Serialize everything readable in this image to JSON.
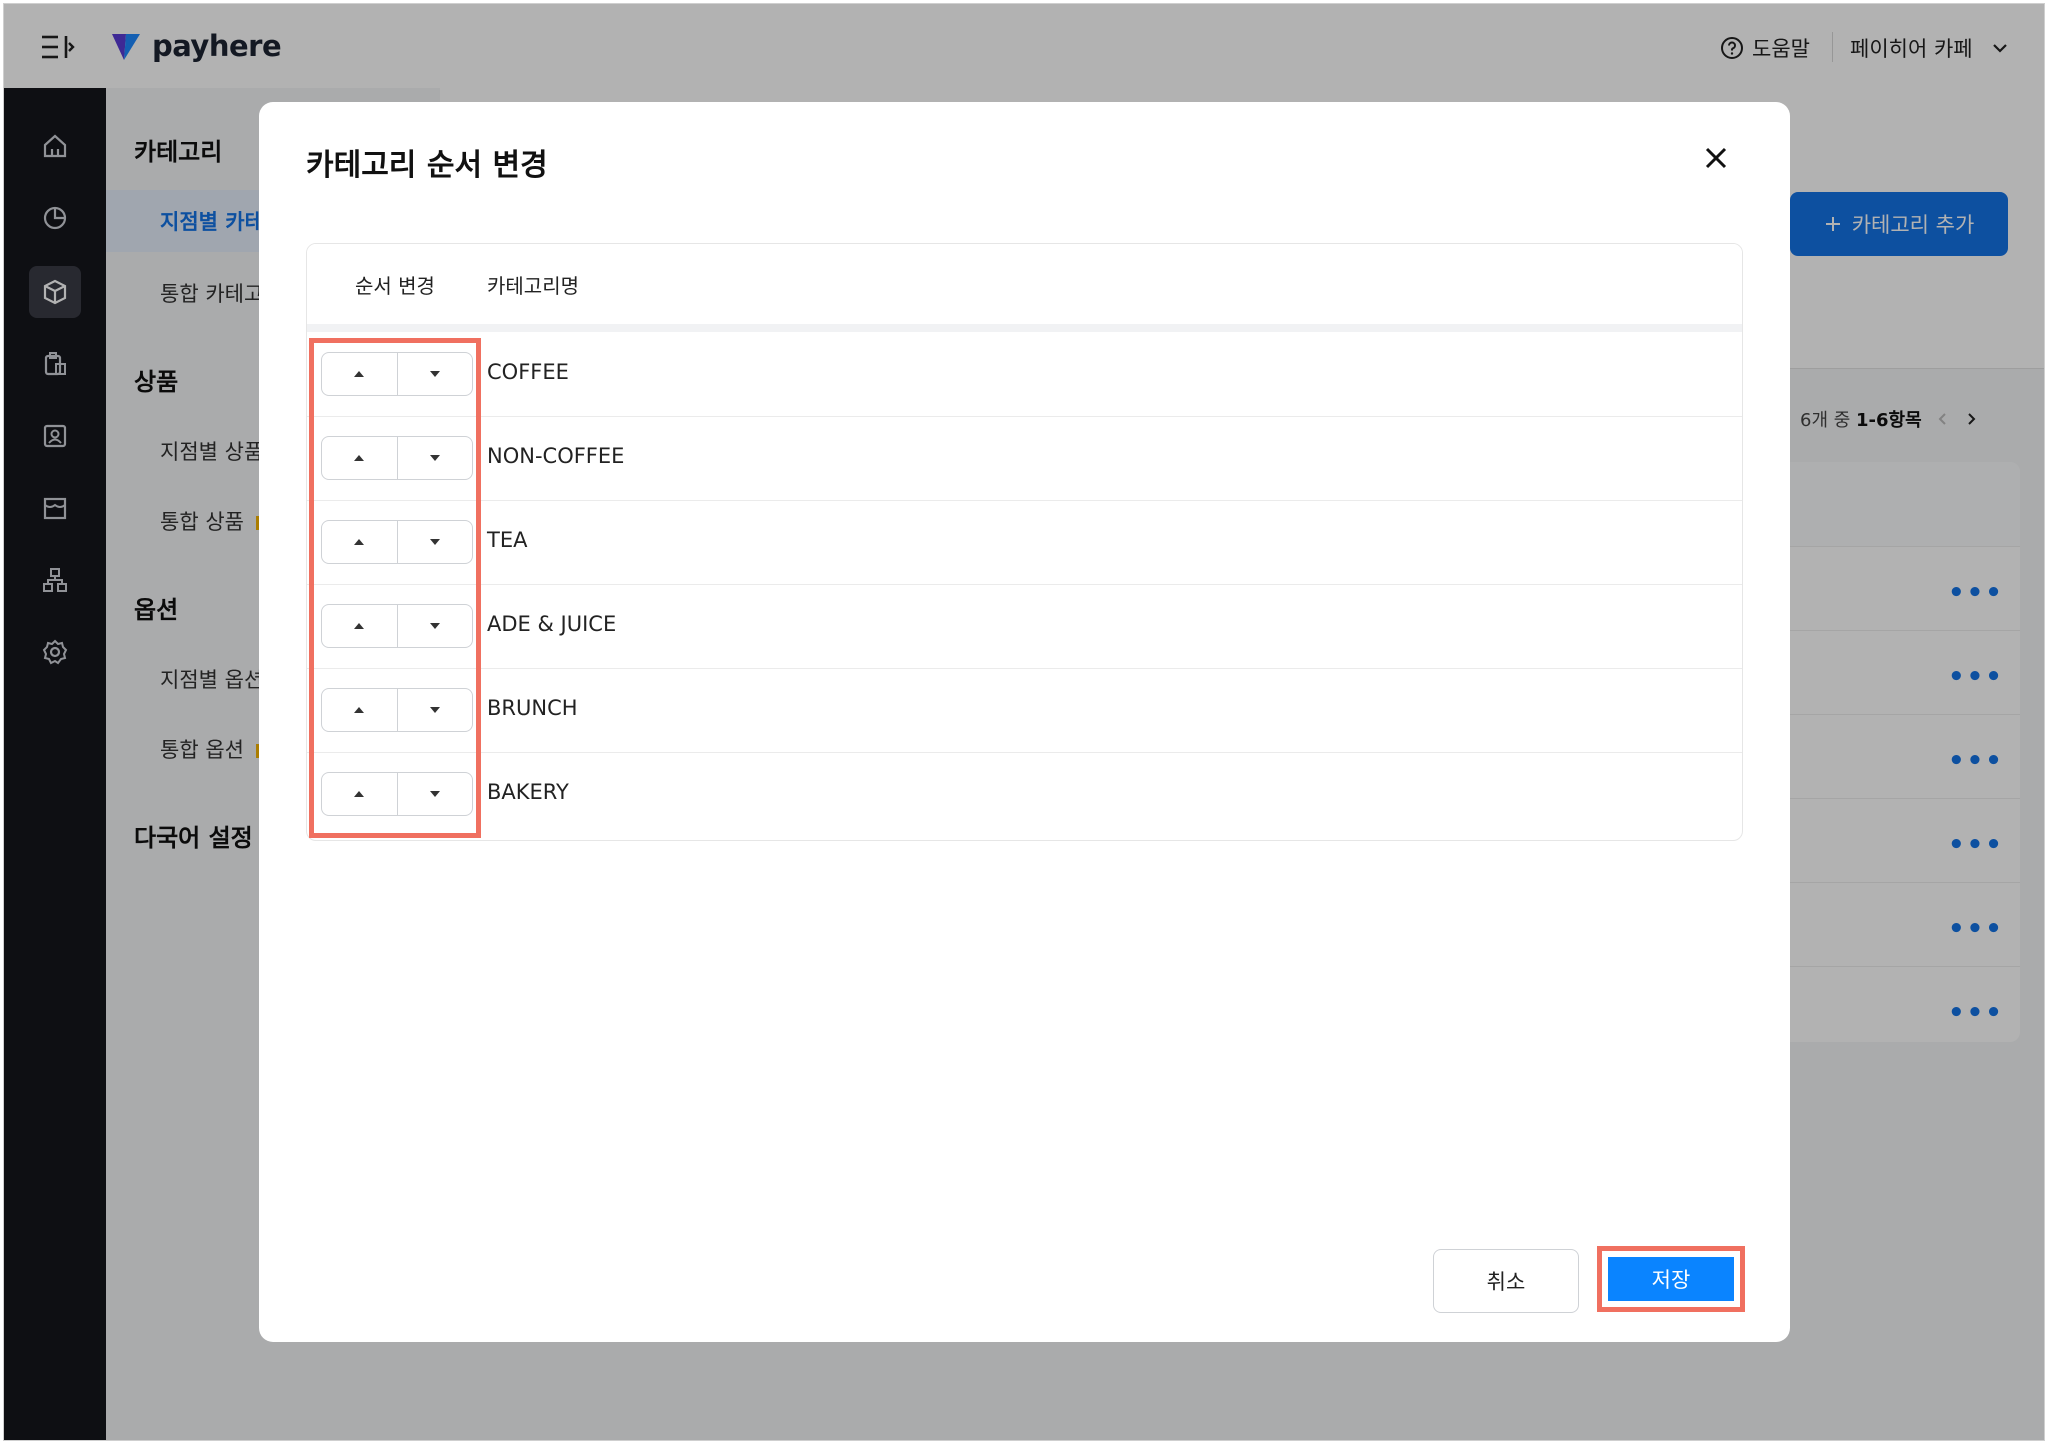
{
  "app": {
    "logo_text": "payhere",
    "help_label": "도움말",
    "store_name": "페이히어 카페"
  },
  "subnav": {
    "groups": [
      {
        "label": "카테고리",
        "items": [
          {
            "label": "지점별 카테"
          },
          {
            "label": "통합 카테고"
          }
        ]
      },
      {
        "label": "상품",
        "items": [
          {
            "label": "지점별 상품"
          },
          {
            "label": "통합 상품"
          }
        ]
      },
      {
        "label": "옵션",
        "items": [
          {
            "label": "지점별 옵션"
          },
          {
            "label": "통합 옵션"
          }
        ]
      },
      {
        "label": "다국어 설정",
        "items": []
      }
    ]
  },
  "main": {
    "add_button_label": "카테고리 추가",
    "pager_prefix": "6개 중",
    "pager_range": "1-6항목"
  },
  "modal": {
    "title": "카테고리 순서 변경",
    "columns": [
      "순서 변경",
      "카테고리명"
    ],
    "rows": [
      {
        "name": "COFFEE"
      },
      {
        "name": "NON-COFFEE"
      },
      {
        "name": "TEA"
      },
      {
        "name": "ADE & JUICE"
      },
      {
        "name": "BRUNCH"
      },
      {
        "name": "BAKERY"
      }
    ],
    "cancel_label": "취소",
    "save_label": "저장"
  },
  "colors": {
    "accent": "#1473e6",
    "save": "#0a84ff",
    "highlight": "#f07060",
    "rail": "#15161c"
  }
}
